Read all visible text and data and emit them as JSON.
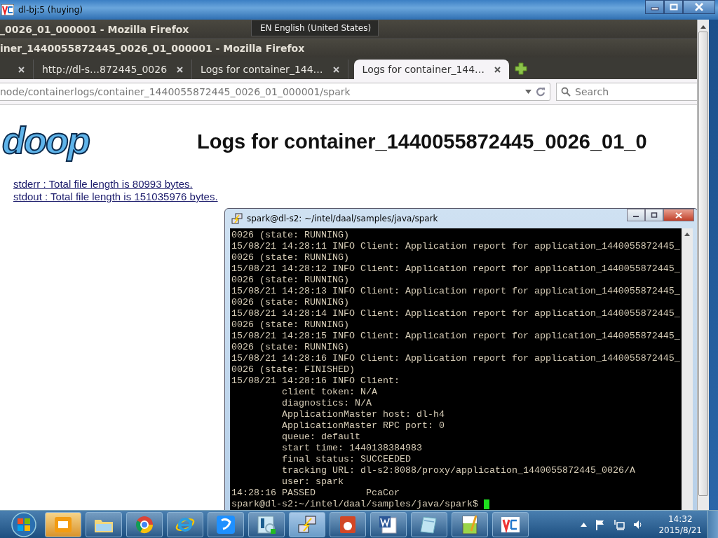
{
  "vnc_window": {
    "title": "dl-bj:5 (huying)"
  },
  "language_bar": {
    "label": "EN English (United States)"
  },
  "firefox": {
    "titles": [
      "_0026_01_000001 - Mozilla Firefox",
      "iner_1440055872445_0026_01_000001 - Mozilla Firefox"
    ],
    "tabs": [
      {
        "selected": false
      },
      {
        "label": "http://dl-s…872445_0026",
        "selected": false
      },
      {
        "label": "Logs for container_144…",
        "selected": false
      },
      {
        "label": "Logs for container_144…",
        "selected": true
      }
    ],
    "url": "node/containerlogs/container_1440055872445_0026_01_000001/spark",
    "search": {
      "placeholder": "Search"
    }
  },
  "page": {
    "logo": "doop",
    "heading": "Logs for container_1440055872445_0026_01_0",
    "links": [
      "stderr : Total file length is 80993 bytes.",
      "stdout : Total file length is 151035976 bytes."
    ]
  },
  "terminal": {
    "title": "spark@dl-s2: ~/intel/daal/samples/java/spark",
    "lines": [
      {
        "text": "0026 (state: RUNNING)",
        "indented": false
      },
      {
        "text": "15/08/21 14:28:11 INFO Client: Application report for application_1440055872445_",
        "indented": false
      },
      {
        "text": "0026 (state: RUNNING)",
        "indented": false
      },
      {
        "text": "15/08/21 14:28:12 INFO Client: Application report for application_1440055872445_",
        "indented": false
      },
      {
        "text": "0026 (state: RUNNING)",
        "indented": false
      },
      {
        "text": "15/08/21 14:28:13 INFO Client: Application report for application_1440055872445_",
        "indented": false
      },
      {
        "text": "0026 (state: RUNNING)",
        "indented": false
      },
      {
        "text": "15/08/21 14:28:14 INFO Client: Application report for application_1440055872445_",
        "indented": false
      },
      {
        "text": "0026 (state: RUNNING)",
        "indented": false
      },
      {
        "text": "15/08/21 14:28:15 INFO Client: Application report for application_1440055872445_",
        "indented": false
      },
      {
        "text": "0026 (state: RUNNING)",
        "indented": false
      },
      {
        "text": "15/08/21 14:28:16 INFO Client: Application report for application_1440055872445_",
        "indented": false
      },
      {
        "text": "0026 (state: FINISHED)",
        "indented": false
      },
      {
        "text": "15/08/21 14:28:16 INFO Client:",
        "indented": false
      },
      {
        "text": "client token: N/A",
        "indented": true
      },
      {
        "text": "diagnostics: N/A",
        "indented": true
      },
      {
        "text": "ApplicationMaster host: dl-h4",
        "indented": true
      },
      {
        "text": "ApplicationMaster RPC port: 0",
        "indented": true
      },
      {
        "text": "queue: default",
        "indented": true
      },
      {
        "text": "start time: 1440138384983",
        "indented": true
      },
      {
        "text": "final status: SUCCEEDED",
        "indented": true
      },
      {
        "text": "tracking URL: dl-s2:8088/proxy/application_1440055872445_0026/A",
        "indented": true
      },
      {
        "text": "user: spark",
        "indented": true
      },
      {
        "text": "14:28:16 PASSED         PcaCor",
        "indented": false
      }
    ],
    "prompt": "spark@dl-s2:~/intel/daal/samples/java/spark$"
  },
  "taskbar": {
    "time": "14:32",
    "date": "2015/8/21"
  }
}
